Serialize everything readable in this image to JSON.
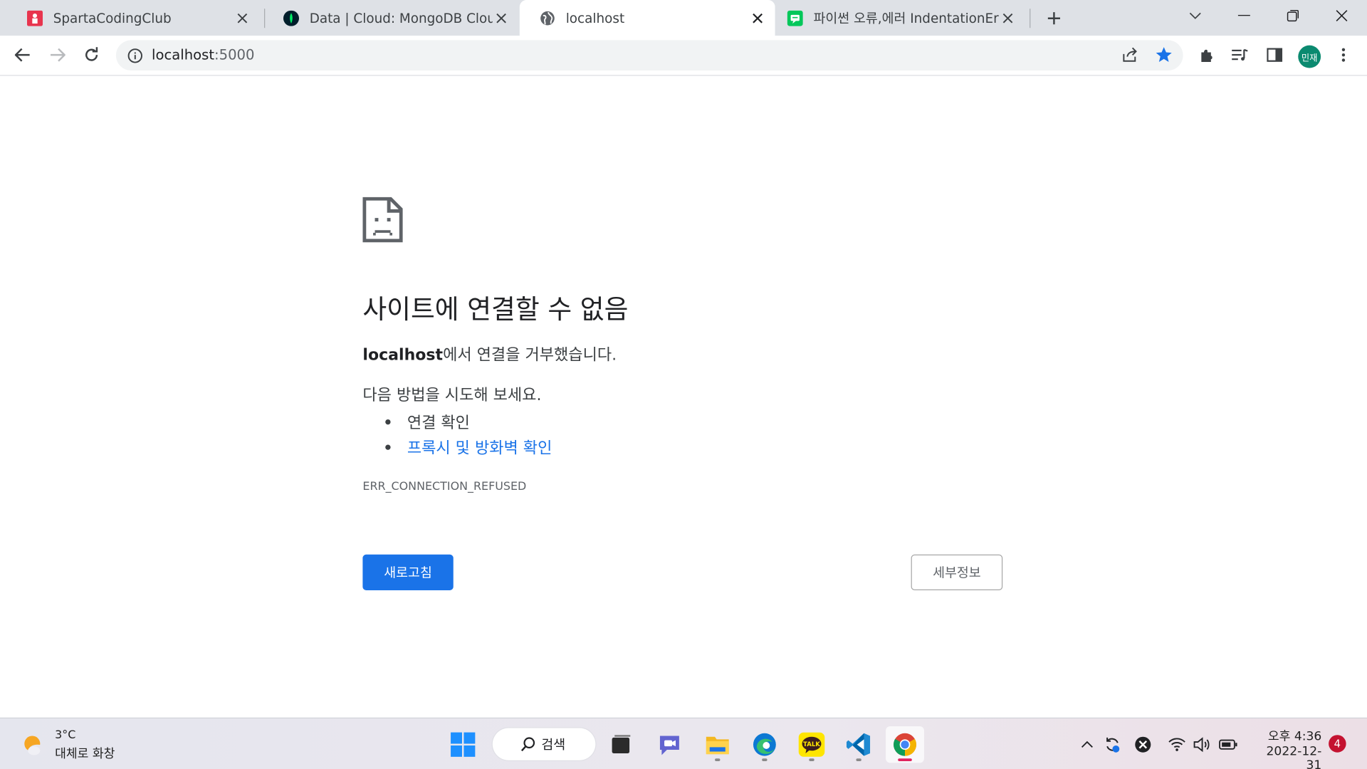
{
  "tabs": [
    {
      "title": "SpartaCodingClub",
      "icon": "sparta-favicon"
    },
    {
      "title": "Data | Cloud: MongoDB Cloud",
      "icon": "mongodb-favicon"
    },
    {
      "title": "localhost",
      "icon": "globe-icon",
      "active": true
    },
    {
      "title": "파이썬 오류,에러 IndentationError",
      "icon": "blog-favicon"
    }
  ],
  "omnibox": {
    "host": "localhost",
    "port": ":5000"
  },
  "profile": {
    "initials": "민재"
  },
  "error_page": {
    "title": "사이트에 연결할 수 없음",
    "host": "localhost",
    "subtitle_suffix": "에서 연결을 거부했습니다.",
    "try_label": "다음 방법을 시도해 보세요.",
    "suggestions": [
      {
        "text": "연결 확인",
        "link": false
      },
      {
        "text": "프록시 및 방화벽 확인",
        "link": true
      }
    ],
    "error_code": "ERR_CONNECTION_REFUSED",
    "reload_button": "새로고침",
    "details_button": "세부정보"
  },
  "taskbar": {
    "weather": {
      "temp": "3°C",
      "desc": "대체로 화창"
    },
    "search_label": "검색",
    "apps": [
      "windows-start",
      "file-explorer-task-view",
      "teams-chat",
      "file-explorer",
      "edge",
      "kakaotalk",
      "vscode",
      "chrome"
    ],
    "clock": {
      "time": "오후 4:36",
      "date": "2022-12-31"
    },
    "notification_count": "4"
  },
  "colors": {
    "accent": "#1a73e8",
    "tab_strip": "#dee1e6",
    "link": "#1a73e8"
  }
}
